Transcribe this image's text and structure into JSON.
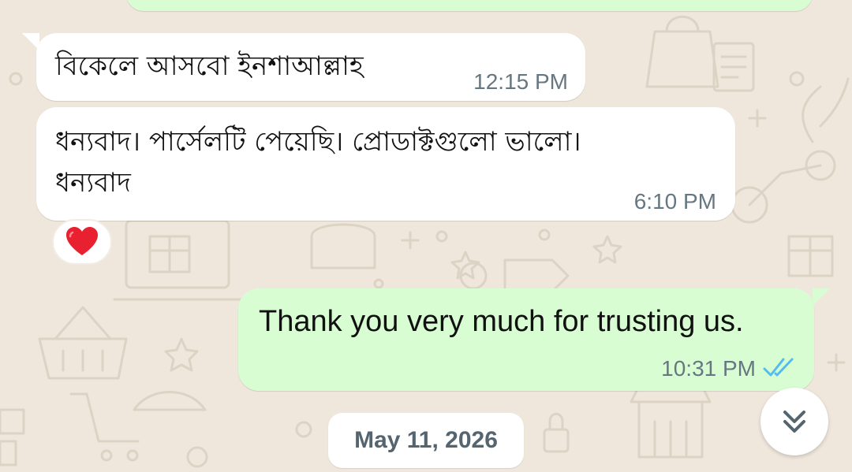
{
  "messages": [
    {
      "direction": "incoming",
      "lines": [
        "বিকেলে আসবো ইনশাআল্লাহ"
      ],
      "time": "12:15 PM"
    },
    {
      "direction": "incoming",
      "lines": [
        "ধন্যবাদ। পার্সেলটি পেয়েছি। প্রোডাক্টগুলো ভালো।",
        "ধন্যবাদ"
      ],
      "time": "6:10 PM",
      "reaction": "❤️"
    },
    {
      "direction": "outgoing",
      "lines": [
        "Thank you very much for trusting us."
      ],
      "time": "10:31 PM",
      "status_icon": "double-check-read-icon"
    }
  ],
  "date_separator": "May 11, 2026",
  "scroll_button": {
    "icon": "double-chevron-down-icon"
  },
  "colors": {
    "incoming_bubble": "#ffffff",
    "outgoing_bubble": "#d9fdd3",
    "wallpaper": "#efe7dc",
    "timestamp": "#667781",
    "read_ticks": "#53bdeb"
  }
}
